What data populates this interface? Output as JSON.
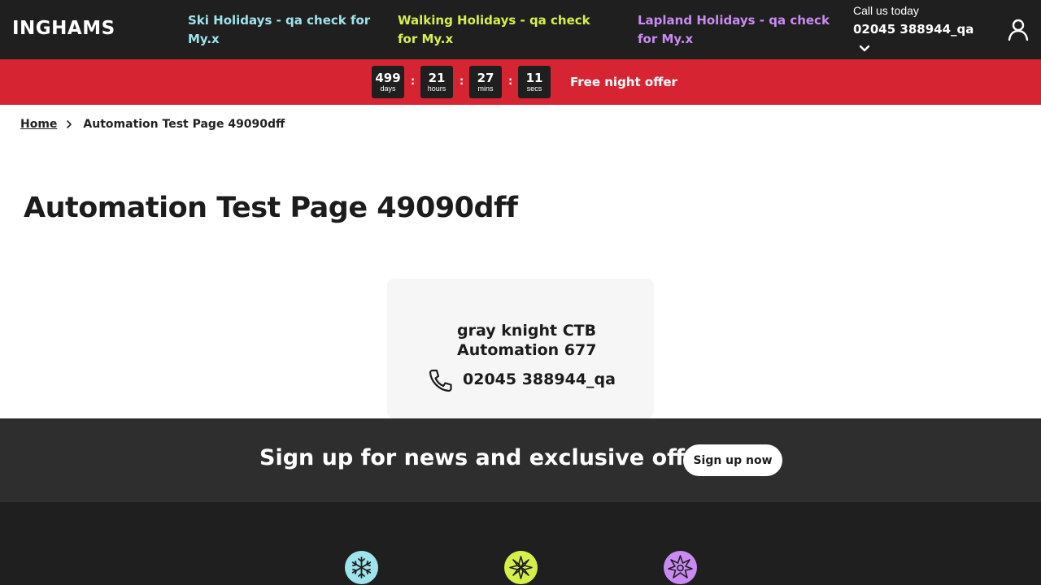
{
  "header": {
    "logo": "INGHAMS",
    "nav": [
      {
        "label": "Ski Holidays - qa check for My.x",
        "color": "#9fe3ec"
      },
      {
        "label": "Walking Holidays - qa check for My.x",
        "color": "#d6f04a"
      },
      {
        "label": "Lapland Holidays - qa check for My.x",
        "color": "#c98bf2"
      }
    ],
    "call_label": "Call us today",
    "call_number": "02045 388944_qa",
    "chevron_icon": "chevron-down-icon",
    "account_icon": "user-icon"
  },
  "promo": {
    "background": "#d62433",
    "countdown": [
      {
        "value": "499",
        "unit": "days"
      },
      {
        "value": "21",
        "unit": "hours"
      },
      {
        "value": "27",
        "unit": "mins"
      },
      {
        "value": "11",
        "unit": "secs"
      }
    ],
    "separator": ":",
    "offer_text": "Free night offer"
  },
  "breadcrumb": {
    "home": "Home",
    "current": "Automation Test Page 49090dff"
  },
  "page": {
    "title": "Automation Test Page 49090dff"
  },
  "card": {
    "name": "gray knight CTB Automation 677",
    "phone": "02045 388944_qa",
    "phone_icon": "phone-icon"
  },
  "signup": {
    "text": "Sign up for news and exclusive offers",
    "button": "Sign up now"
  },
  "footer": {
    "icons": [
      {
        "name": "snowflake-icon",
        "color": "#9fe3ec"
      },
      {
        "name": "flower-icon",
        "color": "#d6f04a"
      },
      {
        "name": "star-icon",
        "color": "#c98bf2"
      }
    ]
  }
}
